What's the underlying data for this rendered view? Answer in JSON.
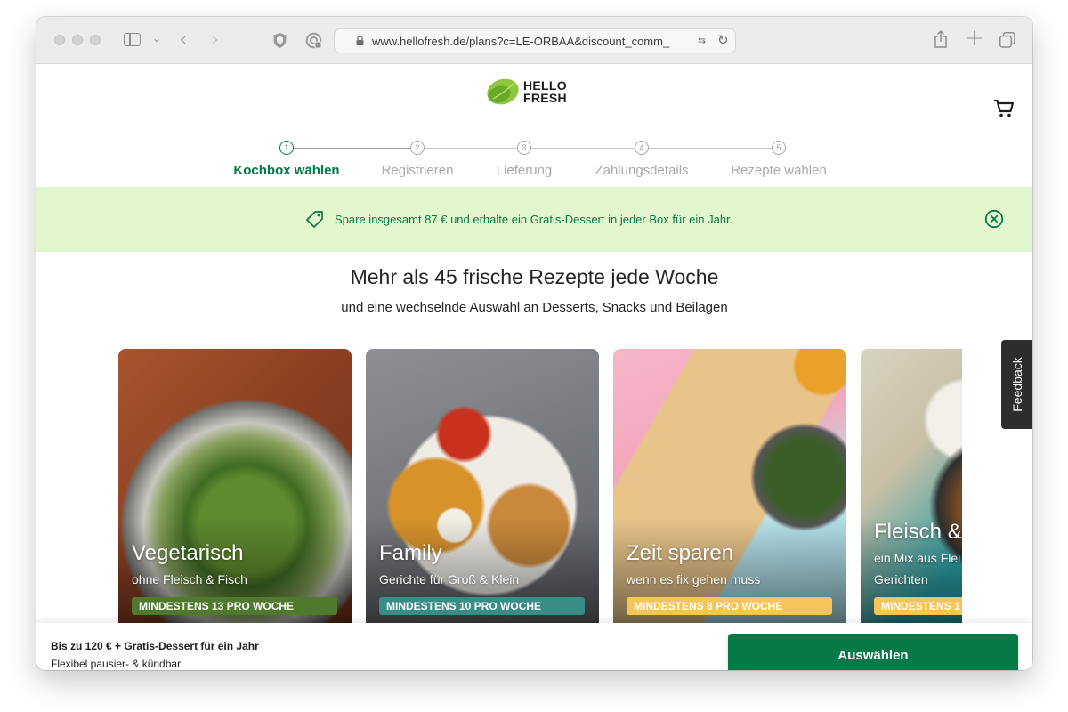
{
  "browser": {
    "url": "www.hellofresh.de/plans?c=LE-ORBAA&discount_comm_",
    "icons": [
      "sidebar-icon",
      "chevron-down-icon",
      "back-arrow-icon",
      "forward-arrow-icon",
      "shield-icon",
      "privacy-report-icon",
      "lock-icon",
      "translate-icon",
      "reload-icon",
      "share-icon",
      "new-tab-icon",
      "tab-overview-icon"
    ]
  },
  "header": {
    "logo_line1": "HELLO",
    "logo_line2": "FRESH",
    "cart_icon": "shopping-cart-icon"
  },
  "stepper": {
    "steps": [
      {
        "number": "1",
        "label": "Kochbox wählen",
        "active": true
      },
      {
        "number": "2",
        "label": "Registrieren",
        "active": false
      },
      {
        "number": "3",
        "label": "Lieferung",
        "active": false
      },
      {
        "number": "4",
        "label": "Zahlungsdetails",
        "active": false
      },
      {
        "number": "5",
        "label": "Rezepte wählen",
        "active": false
      }
    ]
  },
  "promo": {
    "text": "Spare insgesamt 87 € und erhalte ein Gratis-Dessert in jeder Box für ein Jahr.",
    "icon": "price-tag-icon",
    "close_icon": "close-circle-icon",
    "background": "#e3f7ce",
    "text_color": "#067a46"
  },
  "main": {
    "headline": "Mehr als 45 frische Rezepte jede Woche",
    "subline": "und eine wechselnde Auswahl an Desserts, Snacks und Beilagen"
  },
  "plans": [
    {
      "title": "Vegetarisch",
      "subtitle": "ohne Fleisch & Fisch",
      "badge": "MINDESTENS 13 PRO WOCHE",
      "badge_color": "#4f7a2e"
    },
    {
      "title": "Family",
      "subtitle": "Gerichte für Groß & Klein",
      "badge": "MINDESTENS 10 PRO WOCHE",
      "badge_color": "#3a8c86"
    },
    {
      "title": "Zeit sparen",
      "subtitle": "wenn es fix gehen muss",
      "badge": "MINDESTENS 8 PRO WOCHE",
      "badge_color": "#f6c55a"
    },
    {
      "title": "Fleisch &",
      "subtitle": "ein Mix aus Flei",
      "subtitle2": "Gerichten",
      "badge": "MINDESTENS 1",
      "badge_color": "#f6c55a"
    }
  ],
  "feedback": {
    "label": "Feedback"
  },
  "bottom_bar": {
    "title": "Bis zu 120 € + Gratis-Dessert für ein Jahr",
    "subtitle": "Flexibel pausier- & kündbar",
    "cta_label": "Auswählen",
    "cta_color": "#067a46"
  }
}
